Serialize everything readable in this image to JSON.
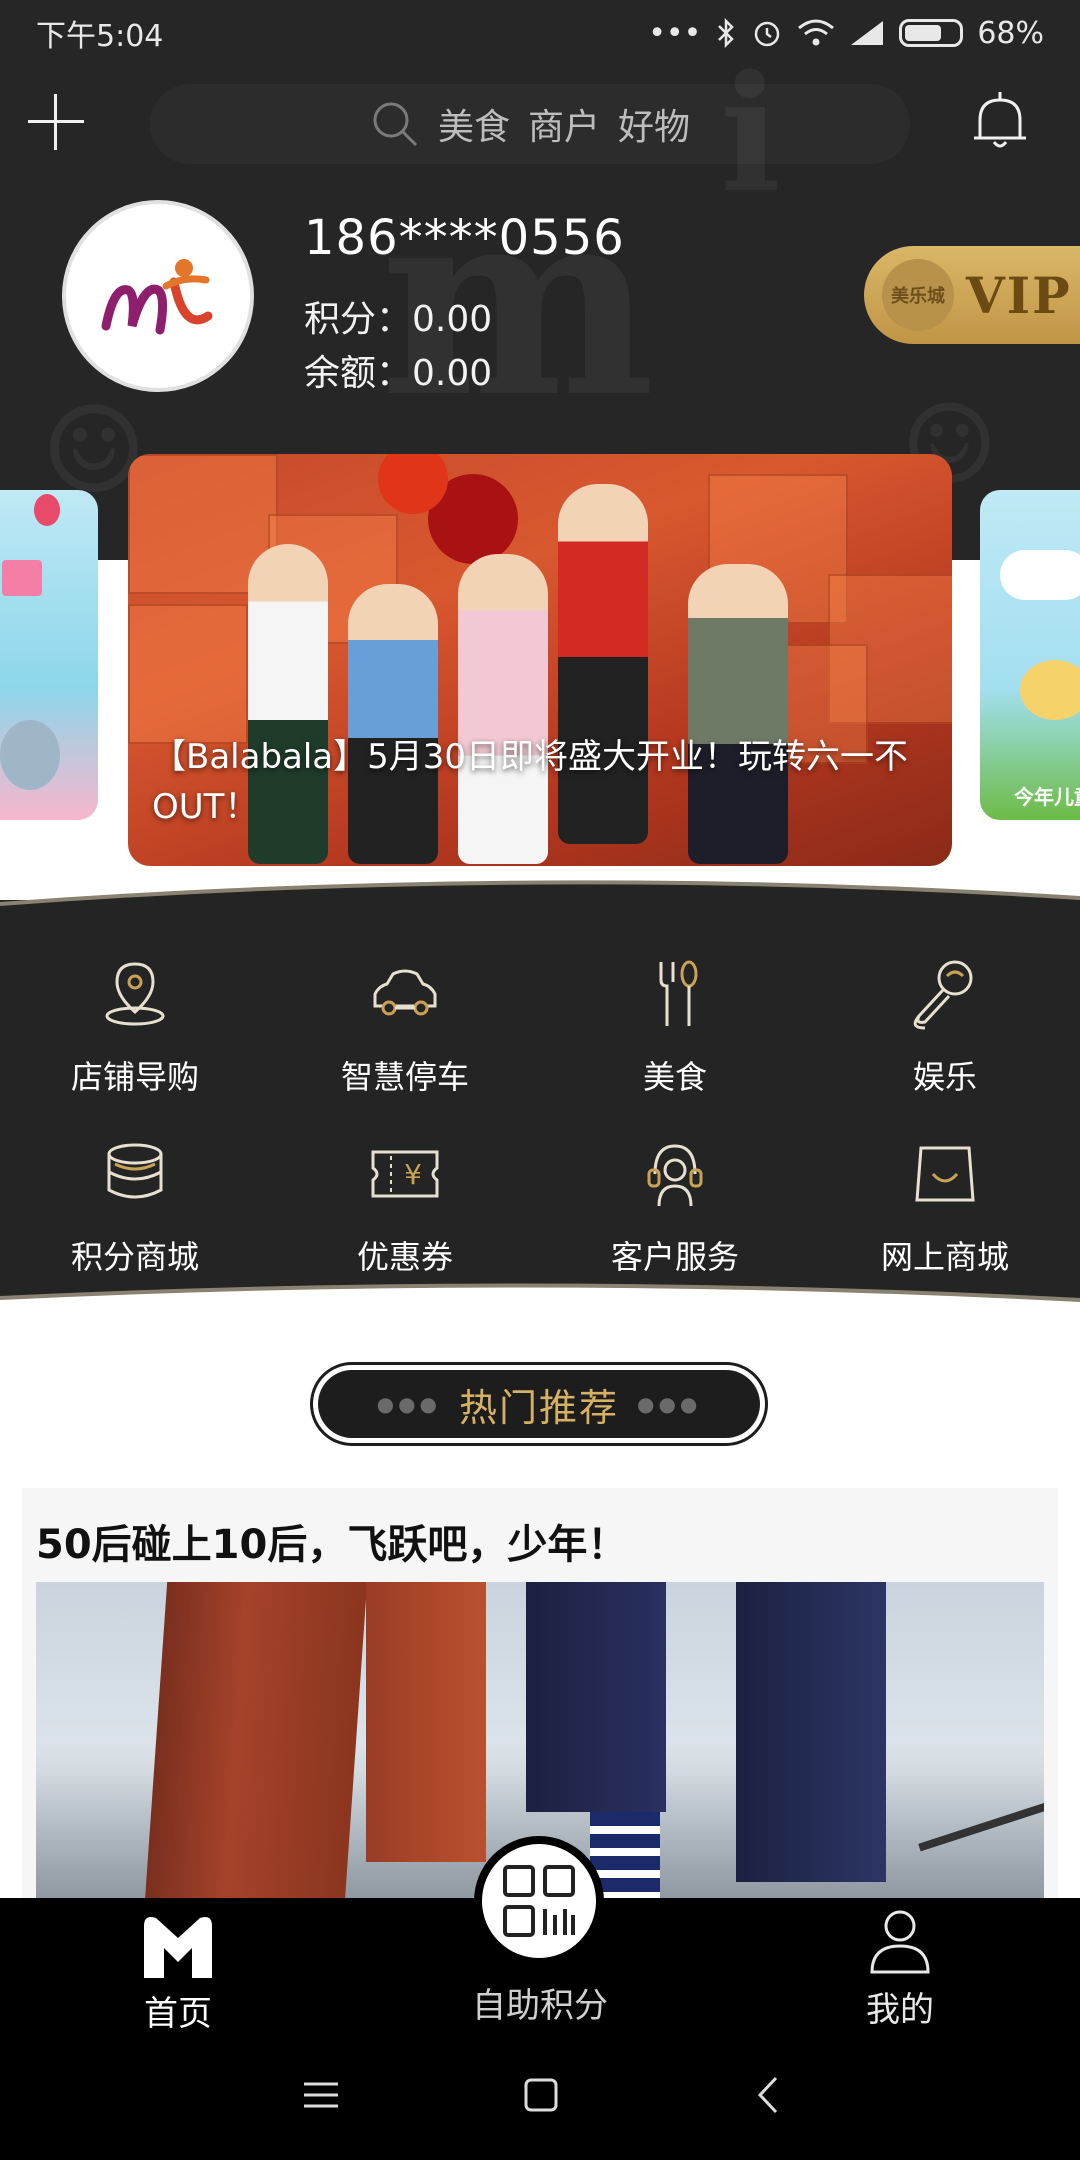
{
  "status": {
    "time": "下午5:04",
    "battery": "68%",
    "battery_level": 0.68
  },
  "search": {
    "keywords": [
      "美食",
      "商户",
      "好物"
    ]
  },
  "user": {
    "phone": "186****0556",
    "points_label": "积分：",
    "points": "0.00",
    "balance_label": "余额：",
    "balance": "0.00",
    "logo_text": "mi"
  },
  "vip": {
    "brand": "美乐城",
    "label": "VIP"
  },
  "carousel": {
    "caption": "【Balabala】5月30日即将盛大开业！玩转六一不OUT！",
    "right_preview_text": "今年儿童"
  },
  "menu": [
    {
      "label": "店铺导购",
      "icon": "location-pin-icon"
    },
    {
      "label": "智慧停车",
      "icon": "car-icon"
    },
    {
      "label": "美食",
      "icon": "fork-spoon-icon"
    },
    {
      "label": "娱乐",
      "icon": "microphone-icon"
    },
    {
      "label": "积分商城",
      "icon": "coin-stack-icon"
    },
    {
      "label": "优惠券",
      "icon": "coupon-icon"
    },
    {
      "label": "客户服务",
      "icon": "headset-icon"
    },
    {
      "label": "网上商城",
      "icon": "shopping-bag-icon"
    }
  ],
  "recommend": {
    "title": "热门推荐",
    "article_title": "50后碰上10后，飞跃吧，少年！"
  },
  "tabs": {
    "home": "首页",
    "scan": "自助积分",
    "me": "我的"
  },
  "colors": {
    "dark_bg": "#262626",
    "gold": "#d6b064",
    "vip_gold": "#c9a255"
  }
}
